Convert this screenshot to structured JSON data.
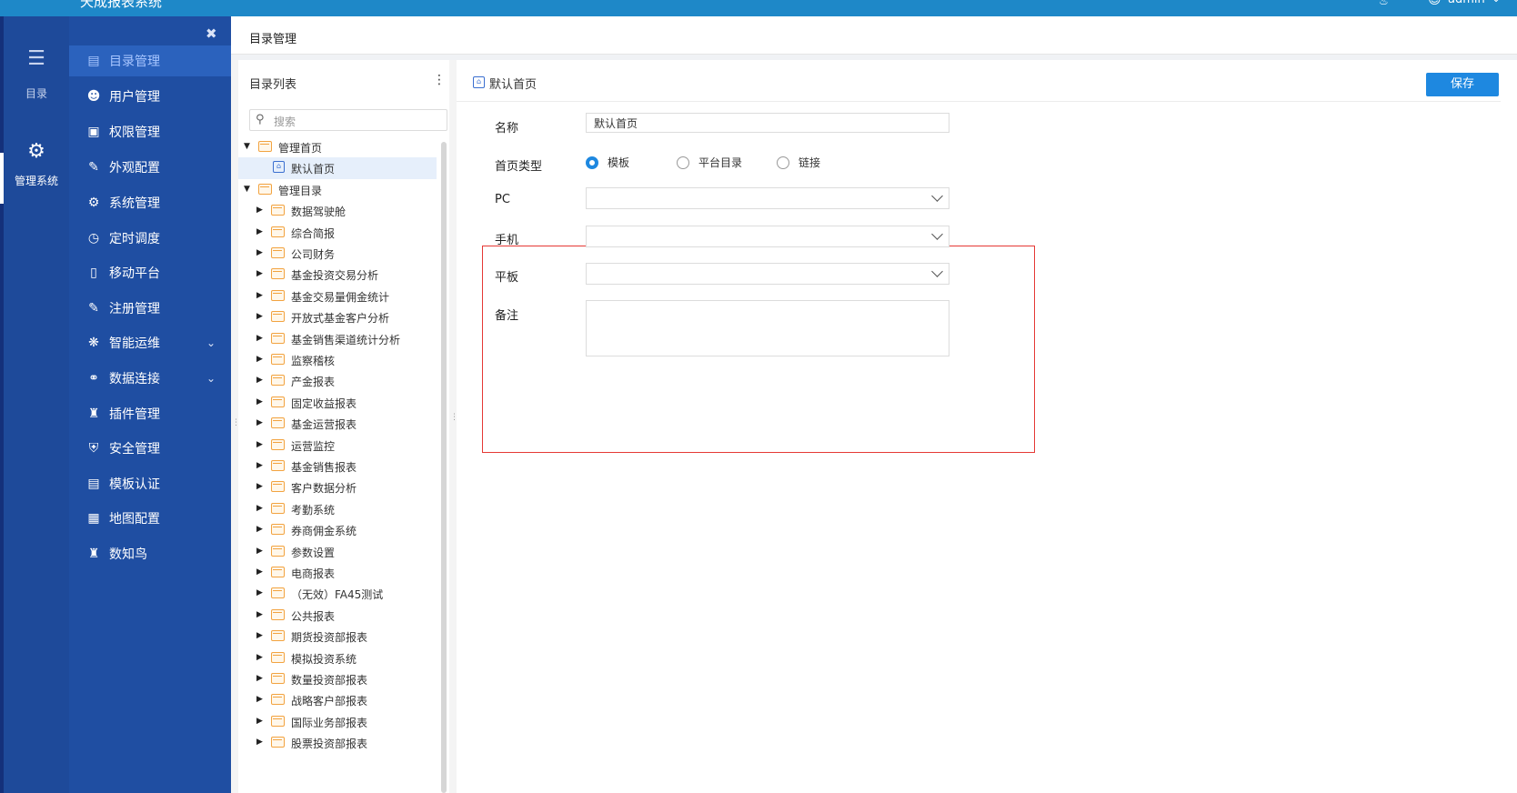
{
  "topbar": {
    "app_title": "天成报表系统",
    "bell_icon": "bell-icon",
    "user_name": "admin"
  },
  "rail": {
    "items": [
      {
        "label": "目录",
        "icon": "list-icon"
      },
      {
        "label": "管理系统",
        "icon": "gear-icon"
      }
    ]
  },
  "sidebar": {
    "collapse_icon": "pin-icon",
    "items": [
      {
        "label": "目录管理",
        "icon": "catalog-icon",
        "active": true
      },
      {
        "label": "用户管理",
        "icon": "user-icon"
      },
      {
        "label": "权限管理",
        "icon": "lock-icon"
      },
      {
        "label": "外观配置",
        "icon": "brush-icon"
      },
      {
        "label": "系统管理",
        "icon": "settings-icon"
      },
      {
        "label": "定时调度",
        "icon": "timer-icon"
      },
      {
        "label": "移动平台",
        "icon": "mobile-icon"
      },
      {
        "label": "注册管理",
        "icon": "register-icon"
      },
      {
        "label": "智能运维",
        "icon": "ops-icon",
        "expandable": true
      },
      {
        "label": "数据连接",
        "icon": "link-icon",
        "expandable": true
      },
      {
        "label": "插件管理",
        "icon": "plugin-icon"
      },
      {
        "label": "安全管理",
        "icon": "shield-icon"
      },
      {
        "label": "模板认证",
        "icon": "template-icon"
      },
      {
        "label": "地图配置",
        "icon": "map-icon"
      },
      {
        "label": "数知鸟",
        "icon": "plugin-icon"
      }
    ]
  },
  "breadcrumb": {
    "title": "目录管理"
  },
  "tree": {
    "header": "目录列表",
    "search_placeholder": "搜索",
    "nodes": [
      {
        "label": "管理首页",
        "level": 0,
        "expanded": true,
        "type": "folder"
      },
      {
        "label": "默认首页",
        "level": 1,
        "type": "home",
        "selected": true
      },
      {
        "label": "管理目录",
        "level": 0,
        "expanded": true,
        "type": "folder"
      },
      {
        "label": "数据驾驶舱",
        "level": 1,
        "type": "folder"
      },
      {
        "label": "综合简报",
        "level": 1,
        "type": "folder"
      },
      {
        "label": "公司财务",
        "level": 1,
        "type": "folder"
      },
      {
        "label": "基金投资交易分析",
        "level": 1,
        "type": "folder"
      },
      {
        "label": "基金交易量佣金统计",
        "level": 1,
        "type": "folder"
      },
      {
        "label": "开放式基金客户分析",
        "level": 1,
        "type": "folder"
      },
      {
        "label": "基金销售渠道统计分析",
        "level": 1,
        "type": "folder"
      },
      {
        "label": "监察稽核",
        "level": 1,
        "type": "folder"
      },
      {
        "label": "产金报表",
        "level": 1,
        "type": "folder"
      },
      {
        "label": "固定收益报表",
        "level": 1,
        "type": "folder"
      },
      {
        "label": "基金运营报表",
        "level": 1,
        "type": "folder"
      },
      {
        "label": "运营监控",
        "level": 1,
        "type": "folder"
      },
      {
        "label": "基金销售报表",
        "level": 1,
        "type": "folder"
      },
      {
        "label": "客户数据分析",
        "level": 1,
        "type": "folder"
      },
      {
        "label": "考勤系统",
        "level": 1,
        "type": "folder"
      },
      {
        "label": "券商佣金系统",
        "level": 1,
        "type": "folder"
      },
      {
        "label": "参数设置",
        "level": 1,
        "type": "folder"
      },
      {
        "label": "电商报表",
        "level": 1,
        "type": "folder"
      },
      {
        "label": "（无效）FA45测试",
        "level": 1,
        "type": "folder"
      },
      {
        "label": "公共报表",
        "level": 1,
        "type": "folder"
      },
      {
        "label": "期货投资部报表",
        "level": 1,
        "type": "folder"
      },
      {
        "label": "模拟投资系统",
        "level": 1,
        "type": "folder"
      },
      {
        "label": "数量投资部报表",
        "level": 1,
        "type": "folder"
      },
      {
        "label": "战略客户部报表",
        "level": 1,
        "type": "folder"
      },
      {
        "label": "国际业务部报表",
        "level": 1,
        "type": "folder"
      },
      {
        "label": "股票投资部报表",
        "level": 1,
        "type": "folder"
      }
    ]
  },
  "detail": {
    "header_title": "默认首页",
    "save_label": "保存",
    "name_label": "名称",
    "name_value": "默认首页",
    "type_label": "首页类型",
    "type_options": [
      {
        "label": "模板",
        "checked": true
      },
      {
        "label": "平台目录",
        "checked": false
      },
      {
        "label": "链接",
        "checked": false
      }
    ],
    "pc_label": "PC",
    "mobile_label": "手机",
    "tablet_label": "平板",
    "remark_label": "备注",
    "highlight_color": "#e53935",
    "accent_color": "#1e88e0"
  }
}
